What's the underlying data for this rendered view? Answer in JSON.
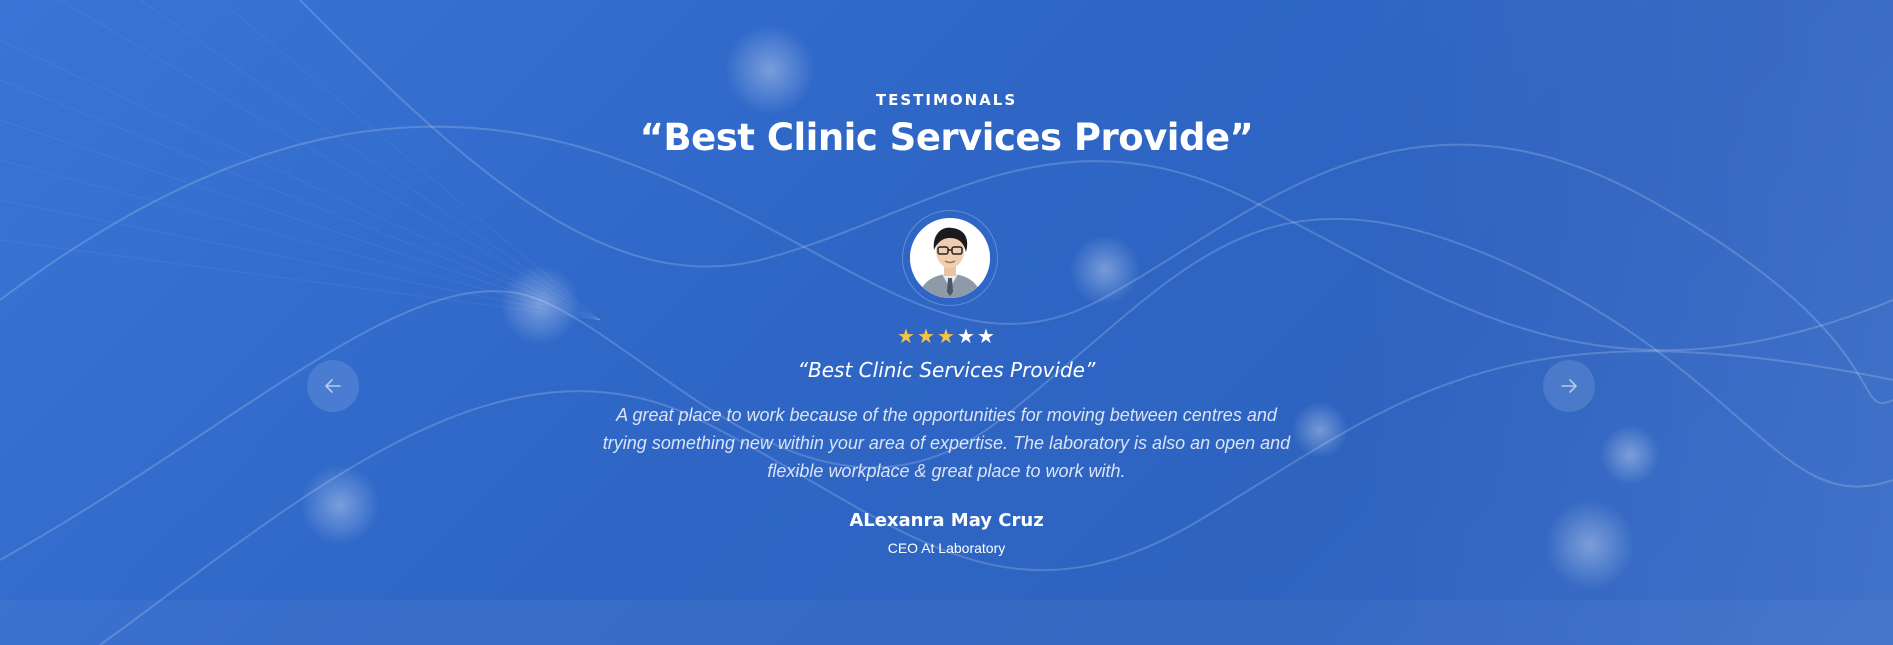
{
  "section": {
    "eyebrow": "TESTIMONALS",
    "heading": "“Best Clinic Services Provide”"
  },
  "testimonial": {
    "avatar_icon": "person-avatar",
    "rating": 3,
    "rating_max": 5,
    "quote_title": "“Best Clinic Services Provide”",
    "quote_body": "A great place to work because of the opportunities for moving between centres and trying something new within your area of expertise. The laboratory is also an open and flexible workplace & great place to work with.",
    "author": "ALexanra May Cruz",
    "role": "CEO At Laboratory"
  },
  "navigation": {
    "prev_icon": "arrow-left-icon",
    "next_icon": "arrow-right-icon"
  },
  "colors": {
    "background": "#2f67c7",
    "star_active": "#f6c443",
    "star_inactive": "#ffffff",
    "text": "#ffffff"
  }
}
